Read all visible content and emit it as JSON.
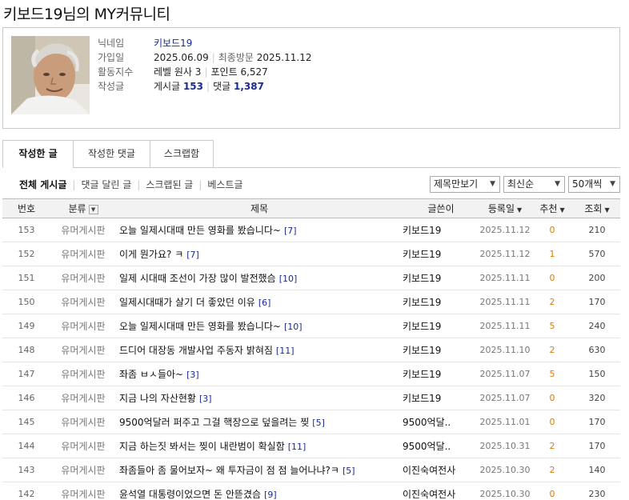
{
  "page_title": "키보드19님의 MY커뮤니티",
  "profile": {
    "labels": {
      "nickname": "닉네임",
      "joined": "가입일",
      "activity": "활동지수",
      "posts": "작성글"
    },
    "nickname": "키보드19",
    "joined_date": "2025.06.09",
    "last_visit_label": "최종방문",
    "last_visit_date": "2025.11.12",
    "level": "레벨 원사 3",
    "points_label": "포인트",
    "points": "6,527",
    "posts_label": "게시글",
    "posts_count": "153",
    "comments_label": "댓글",
    "comments_count": "1,387"
  },
  "tabs": [
    "작성한 글",
    "작성한 댓글",
    "스크랩함"
  ],
  "filters": [
    "전체 게시글",
    "댓글 달린 글",
    "스크랩된 글",
    "베스트글"
  ],
  "selects": {
    "view_mode": "제목만보기",
    "sort": "최신순",
    "per_page": "50개씩"
  },
  "table": {
    "headers": {
      "no": "번호",
      "category": "분류",
      "title": "제목",
      "author": "글쓴이",
      "date": "등록일",
      "likes": "추천",
      "views": "조회"
    },
    "rows": [
      {
        "no": "153",
        "category": "유머게시판",
        "title": "오늘 일제시대때 만든 영화를 봤습니다~",
        "comments": "[7]",
        "author": "키보드19",
        "date": "2025.11.12",
        "likes": "0",
        "views": "210"
      },
      {
        "no": "152",
        "category": "유머게시판",
        "title": "이게 뭔가요? ㅋ",
        "comments": "[7]",
        "author": "키보드19",
        "date": "2025.11.12",
        "likes": "1",
        "views": "570"
      },
      {
        "no": "151",
        "category": "유머게시판",
        "title": "일제 시대때 조선이 가장 많이 발전했슴",
        "comments": "[10]",
        "author": "키보드19",
        "date": "2025.11.11",
        "likes": "0",
        "views": "200"
      },
      {
        "no": "150",
        "category": "유머게시판",
        "title": "일제시대때가 살기 더 좋았던 이유",
        "comments": "[6]",
        "author": "키보드19",
        "date": "2025.11.11",
        "likes": "2",
        "views": "170"
      },
      {
        "no": "149",
        "category": "유머게시판",
        "title": "오늘 일제시대때 만든 영화를 봤습니다~",
        "comments": "[10]",
        "author": "키보드19",
        "date": "2025.11.11",
        "likes": "5",
        "views": "240"
      },
      {
        "no": "148",
        "category": "유머게시판",
        "title": "드디어 대장동 개발사업 주동자 밝혀짐",
        "comments": "[11]",
        "author": "키보드19",
        "date": "2025.11.10",
        "likes": "2",
        "views": "630"
      },
      {
        "no": "147",
        "category": "유머게시판",
        "title": "좌좀 ㅂㅅ들아~",
        "comments": "[3]",
        "author": "키보드19",
        "date": "2025.11.07",
        "likes": "5",
        "views": "150"
      },
      {
        "no": "146",
        "category": "유머게시판",
        "title": "지금 나의 자산현황",
        "comments": "[3]",
        "author": "키보드19",
        "date": "2025.11.07",
        "likes": "0",
        "views": "320"
      },
      {
        "no": "145",
        "category": "유머게시판",
        "title": "9500억달러 퍼주고 그걸 핵장으로 덮을려는 찢",
        "comments": "[5]",
        "author": "9500억달..",
        "date": "2025.11.01",
        "likes": "0",
        "views": "170"
      },
      {
        "no": "144",
        "category": "유머게시판",
        "title": "지금 하는짓 봐서는 찢이 내란범이 확실함",
        "comments": "[11]",
        "author": "9500억달..",
        "date": "2025.10.31",
        "likes": "2",
        "views": "170"
      },
      {
        "no": "143",
        "category": "유머게시판",
        "title": "좌좀들아 좀 물어보자~ 왜 투자금이 점 점 늘어나냐?ㅋ",
        "comments": "[5]",
        "author": "이진숙여전사",
        "date": "2025.10.30",
        "likes": "2",
        "views": "140"
      },
      {
        "no": "142",
        "category": "유머게시판",
        "title": "윤석열 대통령이었으면 돈 안뜯겼슴",
        "comments": "[9]",
        "author": "이진숙여전사",
        "date": "2025.10.30",
        "likes": "0",
        "views": "230"
      }
    ]
  },
  "colors": {
    "accent_link": "#1a2b8f",
    "like_orange": "#e07a00",
    "border": "#c9c9c9",
    "header_bg": "#f2f2f2"
  }
}
